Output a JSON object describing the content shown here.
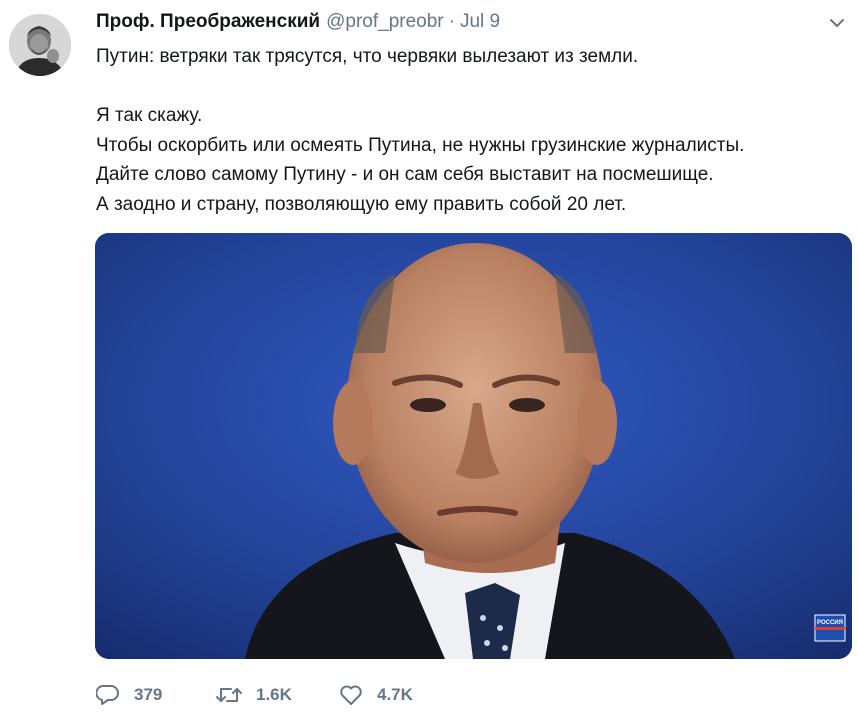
{
  "tweet": {
    "author_name": "Проф. Преображенский",
    "handle": "@prof_preobr",
    "separator": "·",
    "timestamp": "Jul 9",
    "text_lines": [
      "Путин: ветряки так трясутся, что червяки вылезают из земли.",
      "Я так скажу.",
      "Чтобы оскорбить или осмеять Путина, не нужны грузинские журналисты.",
      "Дайте слово самому Путину - и он сам себя выставит на посмешище.",
      "А заодно и страну, позволяющую ему править собой 20 лет."
    ],
    "media": {
      "watermark": "РОССИЯ",
      "background_color": "#1b3c92"
    },
    "actions": {
      "reply_count": "379",
      "retweet_count": "1.6K",
      "like_count": "4.7K"
    }
  },
  "icons": {
    "reply": "reply-icon",
    "retweet": "retweet-icon",
    "like": "heart-icon",
    "menu": "chevron-down-icon"
  },
  "colors": {
    "text": "#14171a",
    "secondary": "#657786"
  }
}
